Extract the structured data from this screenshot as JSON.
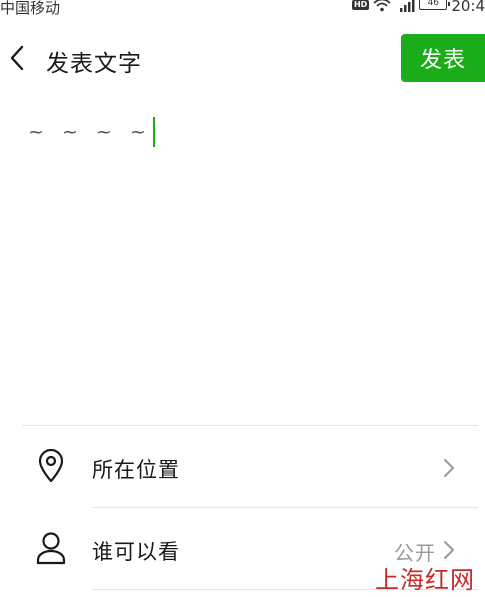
{
  "status_bar": {
    "carrier": "中国移动",
    "hd_badge": "HD",
    "battery_level": "46",
    "time": "20:4"
  },
  "header": {
    "title": "发表文字",
    "publish_label": "发表"
  },
  "editor": {
    "text": "~ ~ ~ ~"
  },
  "options": [
    {
      "label": "所在位置",
      "value": ""
    },
    {
      "label": "谁可以看",
      "value": "公开"
    }
  ],
  "watermark": "上海红网",
  "colors": {
    "accent": "#1aad19",
    "watermark": "#c52a2a"
  },
  "icons": {
    "back": "back-chevron-icon",
    "location": "location-pin-icon",
    "visibility": "person-icon",
    "chevron": "chevron-right-icon"
  }
}
